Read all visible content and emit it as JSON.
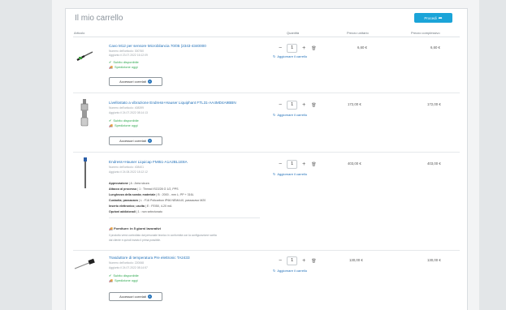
{
  "cart": {
    "title": "Il mio carrello",
    "checkout_label": "Procedi",
    "columns": [
      "Articolo",
      "Quantità",
      "Prezzo unitario",
      "Prezzo complessivo"
    ],
    "update_label": "Aggiornare il carrello",
    "accessories_label": "Accessori correlati",
    "availability": "Subito disponibile",
    "shipping": "Spedizione oggi",
    "items": [
      {
        "name": "Cavo M12 per sensore Microbilancia 70/05 (2343-4340000",
        "article_no": "Numero dell'articolo: 300760",
        "added": "Aggiunto il 23.07.2022 16:12:09",
        "quantity": "1",
        "unit_price": "6,60 €",
        "total_price": "6,60 €"
      },
      {
        "name": "Livellostato a vibrazione Endress+Hauser Liquiphant FTL31-AA4MD4A9BBN",
        "article_no": "Numero dell'articolo: 408399",
        "added": "Aggiunto il 24.07.2022 08:14:13",
        "quantity": "1",
        "unit_price": "172,00 €",
        "total_price": "172,00 €"
      },
      {
        "name": "Endress+Hauser Liquicap FMI51-A1A2BL1E8A",
        "article_no": "Numero dell'articolo: 408401",
        "added": "Aggiunto il 24.08.2022 18:12:12",
        "quantity": "1",
        "unit_price": "403,00 €",
        "total_price": "403,00 €",
        "specs": [
          {
            "label": "Approvazione",
            "value": "A : Area sicura"
          },
          {
            "label": "Attacco al processo",
            "value": "1 : Thread ISO228 G 1/2, PPS"
          },
          {
            "label": "Lunghezza della sonda; materiale",
            "value": "B : 2000 - mm L; PP + 316L"
          },
          {
            "label": "Custodia; passacavo",
            "value": "L : F16 Policarbon IP66 NEMA4X, passacavo M20"
          },
          {
            "label": "Inserto elettronico; uscita",
            "value": "E : FEI50, 4-20 mA"
          },
          {
            "label": "Opzioni addizionali",
            "value": "1 : non selezionato"
          }
        ],
        "supply": "Forniture: in 5 giorni lavorativi",
        "note_1": "Il prodotto verrà controllato dal personale tecnico in conformità con la configurazione scelta",
        "note_2": "dal cliente e quindi inviato il prima possibile."
      },
      {
        "name": "Trasduttore di temperatura Pre elettronic TA2433",
        "article_no": "Numero dell'articolo: 220068",
        "added": "Aggiunto il 24.07.2022 08:14:57",
        "quantity": "1",
        "unit_price": "130,00 €",
        "total_price": "130,00 €"
      }
    ]
  },
  "icons": {
    "minus": "−",
    "plus": "+",
    "trash": "🗑",
    "refresh": "↻",
    "check": "✔",
    "truck": "🚚",
    "arrow": "➦"
  }
}
